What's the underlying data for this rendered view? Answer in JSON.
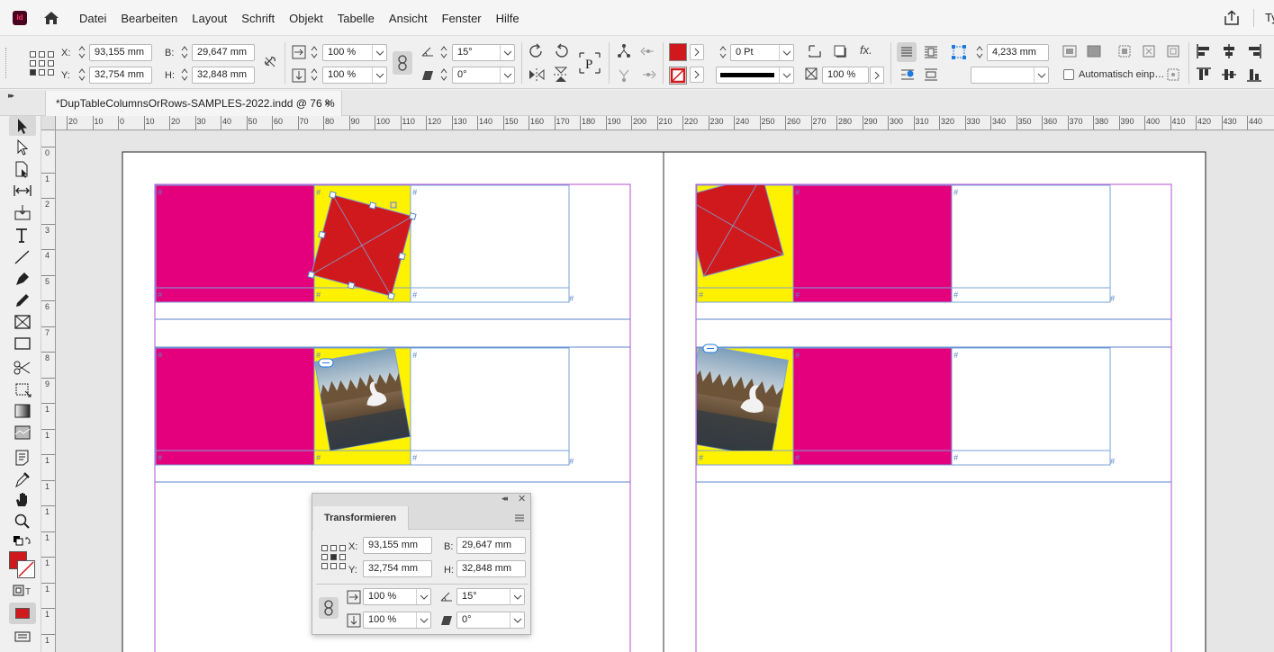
{
  "app": {
    "logo_text": "Id",
    "menu": [
      "Datei",
      "Bearbeiten",
      "Layout",
      "Schrift",
      "Objekt",
      "Tabelle",
      "Ansicht",
      "Fenster",
      "Hilfe"
    ],
    "workspace_label": "Ty"
  },
  "control_panel": {
    "x_label": "X:",
    "x_value": "93,155 mm",
    "y_label": "Y:",
    "y_value": "32,754 mm",
    "w_label": "B:",
    "w_value": "29,647 mm",
    "h_label": "H:",
    "h_value": "32,848 mm",
    "scale_x": "100 %",
    "scale_y": "100 %",
    "rotate": "15°",
    "shear": "0°",
    "stroke_weight": "0 Pt",
    "opacity": "100 %",
    "offset_value": "4,233 mm",
    "auto_fit_label": "Automatisch einp…",
    "fill_color": "#d0191c"
  },
  "document": {
    "tab_title": "*DupTableColumnsOrRows-SAMPLES-2022.indd @ 76 %",
    "close_glyph": "×"
  },
  "ruler": {
    "h_ticks": [
      "20",
      "10",
      "0",
      "10",
      "20",
      "30",
      "40",
      "50",
      "60",
      "70",
      "80",
      "90",
      "100",
      "110",
      "120",
      "130",
      "140",
      "150",
      "160",
      "170",
      "180",
      "190",
      "200",
      "210",
      "220",
      "230",
      "240",
      "250",
      "260",
      "270",
      "280",
      "290",
      "300",
      "310",
      "320",
      "330",
      "340",
      "350",
      "360",
      "370",
      "380",
      "390",
      "400",
      "410",
      "420",
      "430",
      "440"
    ],
    "v_ticks": [
      "0",
      "1",
      "2",
      "3",
      "4",
      "5",
      "6",
      "7",
      "8",
      "9",
      "1",
      "1",
      "1",
      "1",
      "1",
      "1",
      "1",
      "1",
      "1",
      "1"
    ]
  },
  "transform_panel": {
    "title": "Transformieren",
    "x_label": "X:",
    "x_value": "93,155 mm",
    "y_label": "Y:",
    "y_value": "32,754 mm",
    "w_label": "B:",
    "w_value": "29,647 mm",
    "h_label": "H:",
    "h_value": "32,848 mm",
    "scale_x": "100 %",
    "scale_y": "100 %",
    "rotate": "15°",
    "shear": "0°"
  },
  "colors": {
    "magenta": "#e4007c",
    "yellow": "#fff200",
    "red": "#d0191c",
    "frame_blue": "#7aa3d8",
    "margin_purple": "#b84fd6"
  },
  "cell_marker": "#"
}
